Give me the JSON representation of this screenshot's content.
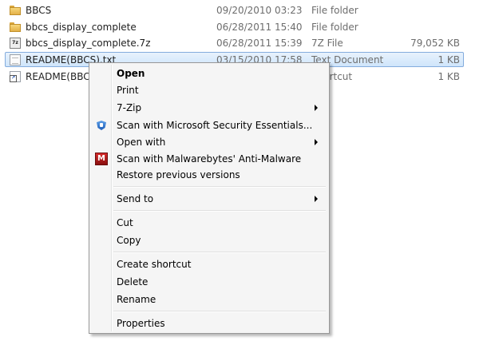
{
  "files": [
    {
      "name": "BBCS",
      "date": "09/20/2010 03:23",
      "type": "File folder",
      "size": "",
      "icon": "folder-icon"
    },
    {
      "name": "bbcs_display_complete",
      "date": "06/28/2011 15:40",
      "type": "File folder",
      "size": "",
      "icon": "folder-icon"
    },
    {
      "name": "bbcs_display_complete.7z",
      "date": "06/28/2011 15:39",
      "type": "7Z File",
      "size": "79,052 KB",
      "icon": "archive-icon",
      "icon_text": "7z"
    },
    {
      "name": "README(BBCS).txt",
      "date": "03/15/2010 17:58",
      "type": "Text Document",
      "size": "1 KB",
      "icon": "text-document-icon"
    },
    {
      "name": "README(BBCS)",
      "date": "",
      "type": "Shortcut",
      "size": "1 KB",
      "icon": "shortcut-icon",
      "icon_text": "↗"
    }
  ],
  "context_menu": {
    "items": [
      {
        "label": "Open"
      },
      {
        "label": "Print"
      },
      {
        "label": "7-Zip"
      },
      {
        "label": "Scan with Microsoft Security Essentials..."
      },
      {
        "label": "Open with"
      },
      {
        "label": "Scan with Malwarebytes' Anti-Malware",
        "icon_text": "M"
      },
      {
        "label": "Restore previous versions"
      },
      {
        "label": "Send to"
      },
      {
        "label": "Cut"
      },
      {
        "label": "Copy"
      },
      {
        "label": "Create shortcut"
      },
      {
        "label": "Delete"
      },
      {
        "label": "Rename"
      },
      {
        "label": "Properties"
      }
    ]
  },
  "colors": {
    "selection": "#cfe5fb",
    "selection_border": "#84acdd",
    "menu_bg": "#f5f5f5"
  }
}
